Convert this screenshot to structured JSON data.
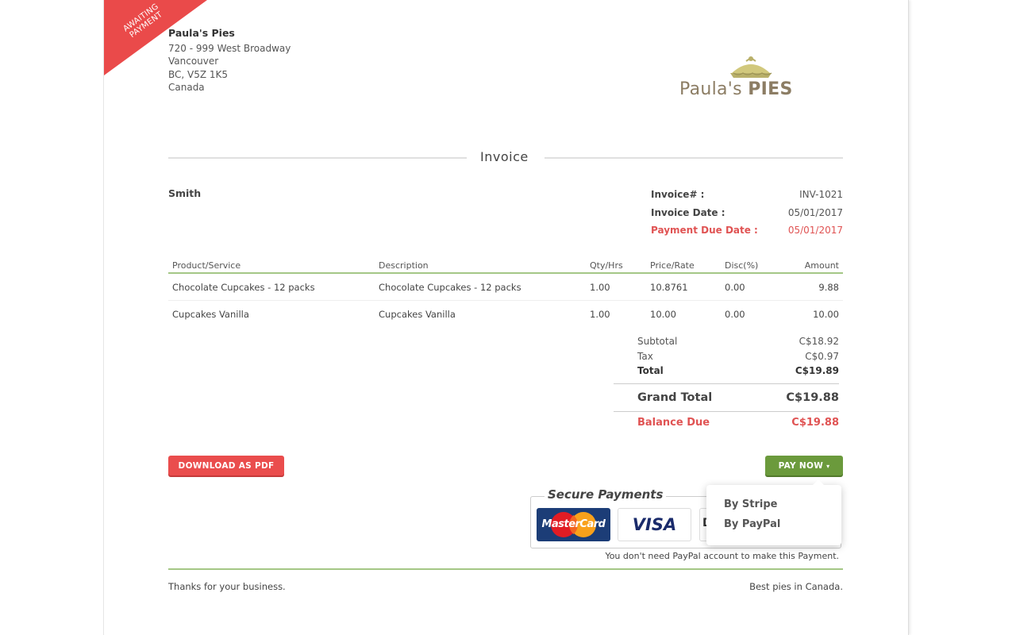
{
  "ribbon": {
    "line1": "AWAITING",
    "line2": "PAYMENT",
    "color": "#ea4a4a"
  },
  "business": {
    "name": "Paula's Pies",
    "address1": "720 - 999 West Broadway",
    "city": "Vancouver",
    "region": "BC, V5Z 1K5",
    "country": "Canada"
  },
  "logo": {
    "text_light": "Paula's ",
    "text_bold": "PIES",
    "icon": "pie-icon"
  },
  "invoice_title": "Invoice",
  "client_name": "Smith",
  "meta": {
    "invoice_no_label": "Invoice# :",
    "invoice_no": "INV-1021",
    "invoice_date_label": "Invoice Date :",
    "invoice_date": "05/01/2017",
    "due_date_label": "Payment Due Date :",
    "due_date": "05/01/2017"
  },
  "table": {
    "headers": [
      "Product/Service",
      "Description",
      "Qty/Hrs",
      "Price/Rate",
      "Disc(%)",
      "Amount"
    ],
    "rows": [
      [
        "Chocolate Cupcakes - 12 packs",
        "Chocolate Cupcakes - 12 packs",
        "1.00",
        "10.8761",
        "0.00",
        "9.88"
      ],
      [
        "Cupcakes Vanilla",
        "Cupcakes Vanilla",
        "1.00",
        "10.00",
        "0.00",
        "10.00"
      ]
    ]
  },
  "totals": {
    "subtotal_label": "Subtotal",
    "subtotal": "C$18.92",
    "tax_label": "Tax",
    "tax": "C$0.97",
    "total_label": "Total",
    "total": "C$19.89",
    "grand_label": "Grand Total",
    "grand": "C$19.88",
    "balance_label": "Balance Due",
    "balance": "C$19.88"
  },
  "buttons": {
    "pdf": "DOWNLOAD AS PDF",
    "pay": "PAY NOW",
    "pay_caret": "▾"
  },
  "payment_menu": {
    "stripe": "By Stripe",
    "paypal": "By PayPal"
  },
  "secure": {
    "title": "Secure Payments",
    "mastercard": "MasterCard",
    "visa": "VISA",
    "third_card_letter": "D",
    "note": "You don't need PayPal account to make this Payment."
  },
  "footer": {
    "left": "Thanks for your business.",
    "right": "Best pies in Canada."
  },
  "colors": {
    "accent_green": "#6b9a3c",
    "accent_red": "#ea4d4d",
    "rule_green": "#a4c786"
  }
}
